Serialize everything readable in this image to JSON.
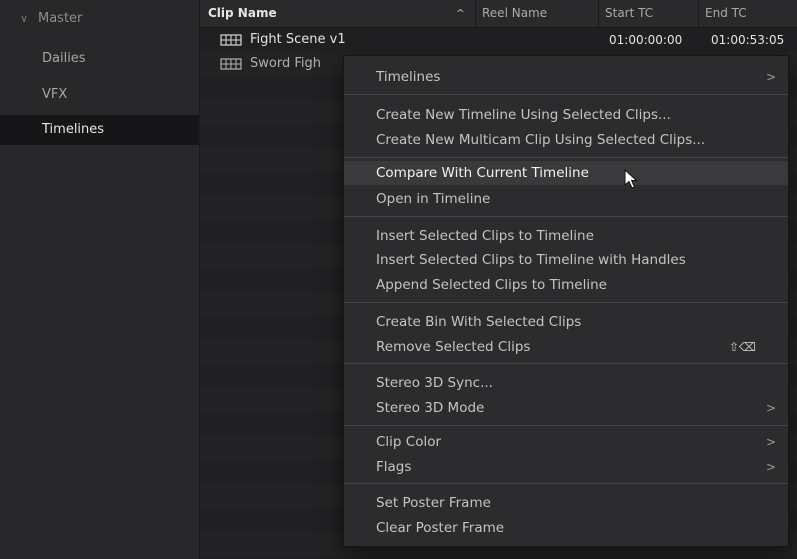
{
  "sidebar": {
    "master": "Master",
    "items": [
      {
        "label": "Dailies"
      },
      {
        "label": "VFX"
      },
      {
        "label": "Timelines"
      }
    ]
  },
  "table": {
    "columns": {
      "clip_name": "Clip Name",
      "reel_name": "Reel Name",
      "start_tc": "Start TC",
      "end_tc": "End TC"
    },
    "rows": [
      {
        "name": "Fight Scene v1",
        "start_tc": "01:00:00:00",
        "end_tc": "01:00:53:05"
      },
      {
        "name": "Sword Figh",
        "start_tc": "",
        "end_tc": ""
      }
    ]
  },
  "context_menu": {
    "timelines": "Timelines",
    "create_new_timeline": "Create New Timeline Using Selected Clips...",
    "create_new_multicam": "Create New Multicam Clip Using Selected Clips...",
    "compare_with_current": "Compare With Current Timeline",
    "open_in_timeline": "Open in Timeline",
    "insert_selected": "Insert Selected Clips to Timeline",
    "insert_selected_handles": "Insert Selected Clips to Timeline with Handles",
    "append_selected": "Append Selected Clips to Timeline",
    "create_bin": "Create Bin With Selected Clips",
    "remove_selected": "Remove Selected Clips",
    "remove_shortcut": "⇧⌫",
    "stereo_sync": "Stereo 3D Sync...",
    "stereo_mode": "Stereo 3D Mode",
    "clip_color": "Clip Color",
    "flags": "Flags",
    "set_poster": "Set Poster Frame",
    "clear_poster": "Clear Poster Frame",
    "submenu_arrow": ">"
  }
}
